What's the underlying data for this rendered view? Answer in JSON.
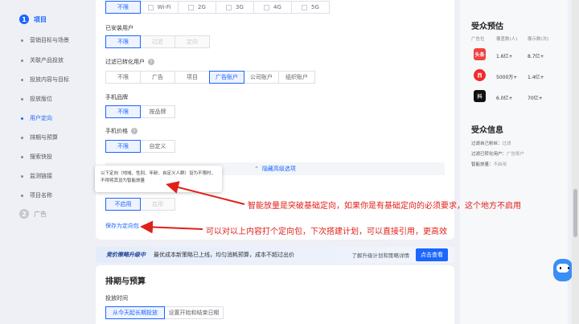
{
  "sidebar": {
    "step1": {
      "num": "1",
      "label": "项目"
    },
    "items": [
      "营销目标与场景",
      "关联产品投放",
      "投放内容与目标",
      "投放版位",
      "用户定向",
      "排期与预算",
      "搜索快投",
      "监测链接",
      "项目名称"
    ],
    "active_index": 4,
    "step2": {
      "num": "2",
      "label": "广告"
    }
  },
  "form": {
    "network": {
      "options": [
        "不限",
        "Wi-Fi",
        "2G",
        "3G",
        "4G",
        "5G"
      ],
      "selected": "不限"
    },
    "installed": {
      "label": "已安装用户",
      "options": [
        "不限",
        "过滤",
        "定向"
      ],
      "selected": "不限"
    },
    "converted": {
      "label": "过滤已转化用户",
      "options": [
        "不限",
        "广告",
        "项目",
        "广告账户",
        "公司账户",
        "组织账户"
      ],
      "selected": "广告账户"
    },
    "brand": {
      "label": "手机品牌",
      "options": [
        "不限",
        "按品牌"
      ],
      "selected": "不限"
    },
    "price": {
      "label": "手机价格",
      "options": [
        "不限",
        "自定义"
      ],
      "selected": "不限"
    },
    "collapse_label": "隐藏高级选项",
    "tooltip_text": "以下定向（地域、性别、年龄、自定义人群）设为不限时，不得将其设为智能放量",
    "smart": {
      "options": [
        "不启用",
        "启用"
      ],
      "selected": "不启用"
    },
    "save_package": "保存为定向包"
  },
  "banner": {
    "title": "竞价策略升级中",
    "desc": "最优成本新策略已上线，均匀消耗预算，成本不超过出价",
    "link": "了解升级计划和策略详情",
    "button": "点击查看"
  },
  "schedule": {
    "title": "排期与预算",
    "time_label": "投放时间",
    "options": [
      "从今天起长期投放",
      "设置开始和结束日期"
    ],
    "selected": "从今天起长期投放"
  },
  "estimate": {
    "title": "受众预估",
    "headers": [
      "广告位",
      "覆盖数(人)",
      "展示数(次)"
    ],
    "rows": [
      {
        "logo": "头条",
        "logo_color": "#f04142",
        "cover": "1.6亿+",
        "show": "8.7亿+"
      },
      {
        "logo": "西",
        "logo_color": "#f12a2a",
        "cover": "5000万+",
        "show": "1.4亿+"
      },
      {
        "logo": "抖",
        "logo_color": "#111111",
        "cover": "6.0亿+",
        "show": "70亿+"
      }
    ]
  },
  "info": {
    "title": "受众信息",
    "items": [
      {
        "k": "过滤自己粉丝：",
        "v": "过滤"
      },
      {
        "k": "过滤已转化用户：",
        "v": "广告账户"
      },
      {
        "k": "智能放量：",
        "v": "不启用"
      }
    ]
  },
  "annotations": {
    "a1": "智能放量是突破基础定向，如果你是有基础定向的必须要求，这个地方不启用",
    "a2": "可以对以上内容打个定向包，下次搭建计划，可以直接引用，更高效"
  }
}
